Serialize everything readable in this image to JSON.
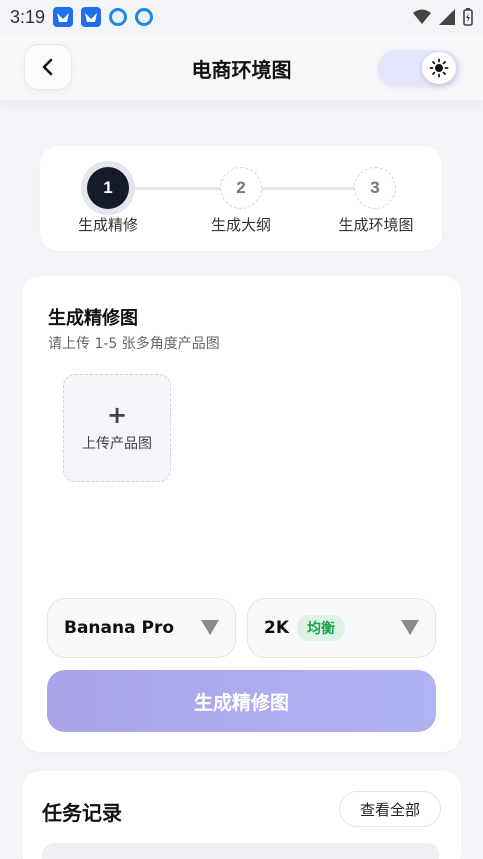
{
  "status_bar": {
    "time": "3:19"
  },
  "header": {
    "title": "电商环境图"
  },
  "stepper": {
    "steps": [
      {
        "number": "1",
        "label": "生成精修"
      },
      {
        "number": "2",
        "label": "生成大纲"
      },
      {
        "number": "3",
        "label": "生成环境图"
      }
    ],
    "active_step": 1
  },
  "main": {
    "title": "生成精修图",
    "subtitle": "请上传 1-5 张多角度产品图",
    "upload": {
      "plus": "+",
      "label": "上传产品图"
    },
    "model_select": {
      "value": "Banana Pro"
    },
    "quality_select": {
      "value": "2K",
      "badge": "均衡"
    },
    "primary_button": "生成精修图"
  },
  "tasks": {
    "title": "任务记录",
    "view_all": "查看全部"
  },
  "colors": {
    "accent_gradient_start": "#a9a3e8",
    "accent_gradient_end": "#b1b3f3",
    "active_step": "#141a28",
    "badge_bg": "#dcf3e6",
    "badge_text": "#16a34a"
  }
}
